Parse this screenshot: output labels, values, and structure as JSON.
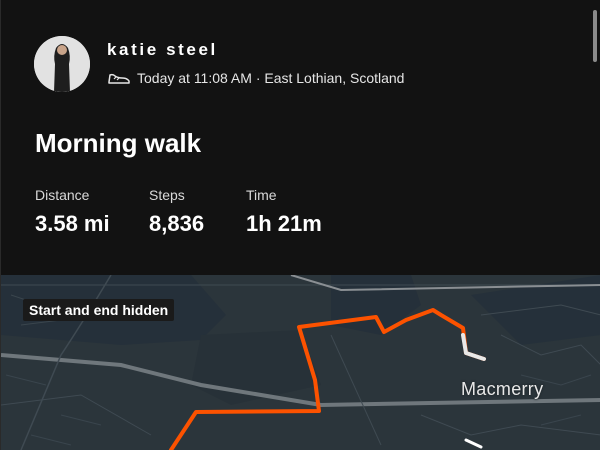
{
  "user": {
    "name": "katie steel",
    "activity_meta": "Today at 11:08 AM · East Lothian, Scotland",
    "activity_icon": "shoe-icon"
  },
  "activity": {
    "title": "Morning walk",
    "stats": [
      {
        "label": "Distance",
        "value": "3.58 mi"
      },
      {
        "label": "Steps",
        "value": "8,836"
      },
      {
        "label": "Time",
        "value": "1h 21m"
      }
    ]
  },
  "map": {
    "badge": "Start and end hidden",
    "place_label": "Macmerry",
    "route_color": "#fc5200"
  }
}
